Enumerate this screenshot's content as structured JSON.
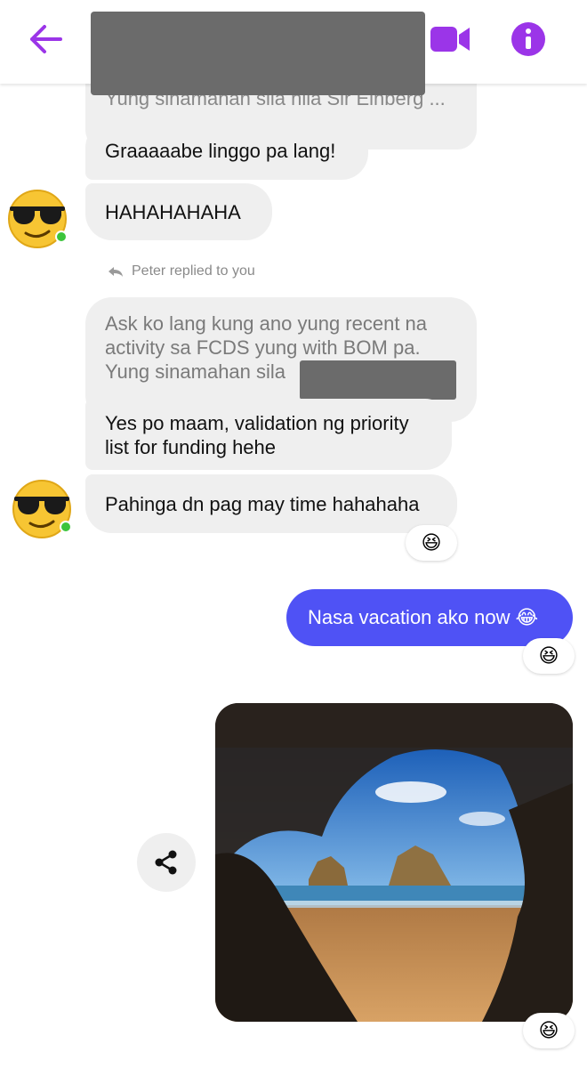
{
  "header": {
    "back_icon": "arrow-left-icon",
    "video_icon": "video-camera-icon",
    "info_icon": "info-icon",
    "accent_color": "#9b35e8"
  },
  "messages": {
    "m1_partial": "Yung sinamahan sila nila Sir Einberg ...",
    "m2": "Graaaaabe linggo pa lang!",
    "m3": "HAHAHAHAHA",
    "reply_indicator": "Peter replied to you",
    "m4_line1": "Ask ko lang kung ano yung recent na",
    "m4_line2": "activity sa FCDS yung with BOM pa.",
    "m4_line3": "Yung sinamahan sila",
    "m5_line1": "Yes po maam, validation ng priority",
    "m5_line2": "list for funding hehe",
    "m6": "Pahinga dn pag may time hahahaha",
    "outgoing": "Nasa vacation ako now",
    "outgoing_emoji": "😂"
  },
  "reactions": {
    "r1": "😆",
    "r2": "😆",
    "r3": "😆"
  },
  "colors": {
    "outgoing_bubble": "#4f52f5",
    "incoming_bubble": "#efefef"
  }
}
